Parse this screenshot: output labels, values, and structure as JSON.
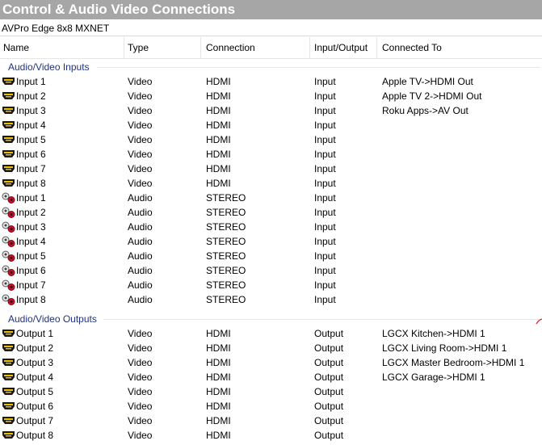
{
  "window": {
    "title": "Control & Audio Video Connections"
  },
  "device": {
    "name": "AVPro Edge 8x8 MXNET"
  },
  "columns": [
    "Name",
    "Type",
    "Connection",
    "Input/Output",
    "Connected To"
  ],
  "groups": [
    {
      "label": "Audio/Video Inputs",
      "rows": [
        {
          "icon": "hdmi-port-icon",
          "name": "Input 1",
          "type": "Video",
          "connection": "HDMI",
          "io": "Input",
          "connected_to": "Apple TV->HDMI Out"
        },
        {
          "icon": "hdmi-port-icon",
          "name": "Input 2",
          "type": "Video",
          "connection": "HDMI",
          "io": "Input",
          "connected_to": "Apple TV 2->HDMI Out"
        },
        {
          "icon": "hdmi-port-icon",
          "name": "Input 3",
          "type": "Video",
          "connection": "HDMI",
          "io": "Input",
          "connected_to": "Roku Apps->AV Out"
        },
        {
          "icon": "hdmi-port-icon",
          "name": "Input 4",
          "type": "Video",
          "connection": "HDMI",
          "io": "Input",
          "connected_to": ""
        },
        {
          "icon": "hdmi-port-icon",
          "name": "Input 5",
          "type": "Video",
          "connection": "HDMI",
          "io": "Input",
          "connected_to": ""
        },
        {
          "icon": "hdmi-port-icon",
          "name": "Input 6",
          "type": "Video",
          "connection": "HDMI",
          "io": "Input",
          "connected_to": ""
        },
        {
          "icon": "hdmi-port-icon",
          "name": "Input 7",
          "type": "Video",
          "connection": "HDMI",
          "io": "Input",
          "connected_to": ""
        },
        {
          "icon": "hdmi-port-icon",
          "name": "Input 8",
          "type": "Video",
          "connection": "HDMI",
          "io": "Input",
          "connected_to": ""
        },
        {
          "icon": "rca-stereo-icon",
          "name": "Input 1",
          "type": "Audio",
          "connection": "STEREO",
          "io": "Input",
          "connected_to": ""
        },
        {
          "icon": "rca-stereo-icon",
          "name": "Input 2",
          "type": "Audio",
          "connection": "STEREO",
          "io": "Input",
          "connected_to": ""
        },
        {
          "icon": "rca-stereo-icon",
          "name": "Input 3",
          "type": "Audio",
          "connection": "STEREO",
          "io": "Input",
          "connected_to": ""
        },
        {
          "icon": "rca-stereo-icon",
          "name": "Input 4",
          "type": "Audio",
          "connection": "STEREO",
          "io": "Input",
          "connected_to": ""
        },
        {
          "icon": "rca-stereo-icon",
          "name": "Input 5",
          "type": "Audio",
          "connection": "STEREO",
          "io": "Input",
          "connected_to": ""
        },
        {
          "icon": "rca-stereo-icon",
          "name": "Input 6",
          "type": "Audio",
          "connection": "STEREO",
          "io": "Input",
          "connected_to": ""
        },
        {
          "icon": "rca-stereo-icon",
          "name": "Input 7",
          "type": "Audio",
          "connection": "STEREO",
          "io": "Input",
          "connected_to": ""
        },
        {
          "icon": "rca-stereo-icon",
          "name": "Input 8",
          "type": "Audio",
          "connection": "STEREO",
          "io": "Input",
          "connected_to": ""
        }
      ]
    },
    {
      "label": "Audio/Video Outputs",
      "rows": [
        {
          "icon": "hdmi-port-icon",
          "name": "Output 1",
          "type": "Video",
          "connection": "HDMI",
          "io": "Output",
          "connected_to": "LGCX Kitchen->HDMI 1"
        },
        {
          "icon": "hdmi-port-icon",
          "name": "Output 2",
          "type": "Video",
          "connection": "HDMI",
          "io": "Output",
          "connected_to": "LGCX Living Room->HDMI 1"
        },
        {
          "icon": "hdmi-port-icon",
          "name": "Output 3",
          "type": "Video",
          "connection": "HDMI",
          "io": "Output",
          "connected_to": "LGCX Master Bedroom->HDMI 1"
        },
        {
          "icon": "hdmi-port-icon",
          "name": "Output 4",
          "type": "Video",
          "connection": "HDMI",
          "io": "Output",
          "connected_to": "LGCX Garage->HDMI 1"
        },
        {
          "icon": "hdmi-port-icon",
          "name": "Output 5",
          "type": "Video",
          "connection": "HDMI",
          "io": "Output",
          "connected_to": ""
        },
        {
          "icon": "hdmi-port-icon",
          "name": "Output 6",
          "type": "Video",
          "connection": "HDMI",
          "io": "Output",
          "connected_to": ""
        },
        {
          "icon": "hdmi-port-icon",
          "name": "Output 7",
          "type": "Video",
          "connection": "HDMI",
          "io": "Output",
          "connected_to": ""
        },
        {
          "icon": "hdmi-port-icon",
          "name": "Output 8",
          "type": "Video",
          "connection": "HDMI",
          "io": "Output",
          "connected_to": ""
        }
      ]
    }
  ],
  "colors": {
    "title_bar": "#a6a6a6",
    "group_label": "#1e3287",
    "rca_red": "#c8102e",
    "corner_mark": "#e0202a"
  }
}
